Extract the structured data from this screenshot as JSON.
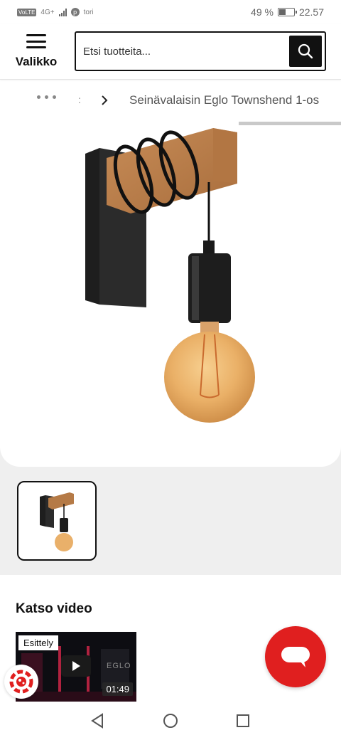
{
  "status_bar": {
    "volte": "VoLTE",
    "network": "4G+",
    "app_label": "tori",
    "battery_text": "49 %",
    "battery_level": 0.49,
    "time": "22.57"
  },
  "header": {
    "menu_label": "Valikko",
    "search_placeholder": "Etsi tuotteita..."
  },
  "breadcrumb": {
    "separator": ":",
    "current": "Seinävalaisin Eglo Townshend 1-os"
  },
  "gallery": {
    "thumbnails": 1,
    "selected_index": 0
  },
  "video_section": {
    "heading": "Katso video",
    "badge": "Esittely",
    "brand_watermark": "EGLO",
    "duration": "01:49"
  },
  "colors": {
    "accent": "#e01f1f",
    "dark": "#111111",
    "gallery_bg": "#efefef"
  },
  "icons": [
    "menu-icon",
    "search-icon",
    "chevron-right-icon",
    "play-icon",
    "chat-icon",
    "cookie-icon",
    "back-icon",
    "home-icon",
    "recents-icon"
  ]
}
